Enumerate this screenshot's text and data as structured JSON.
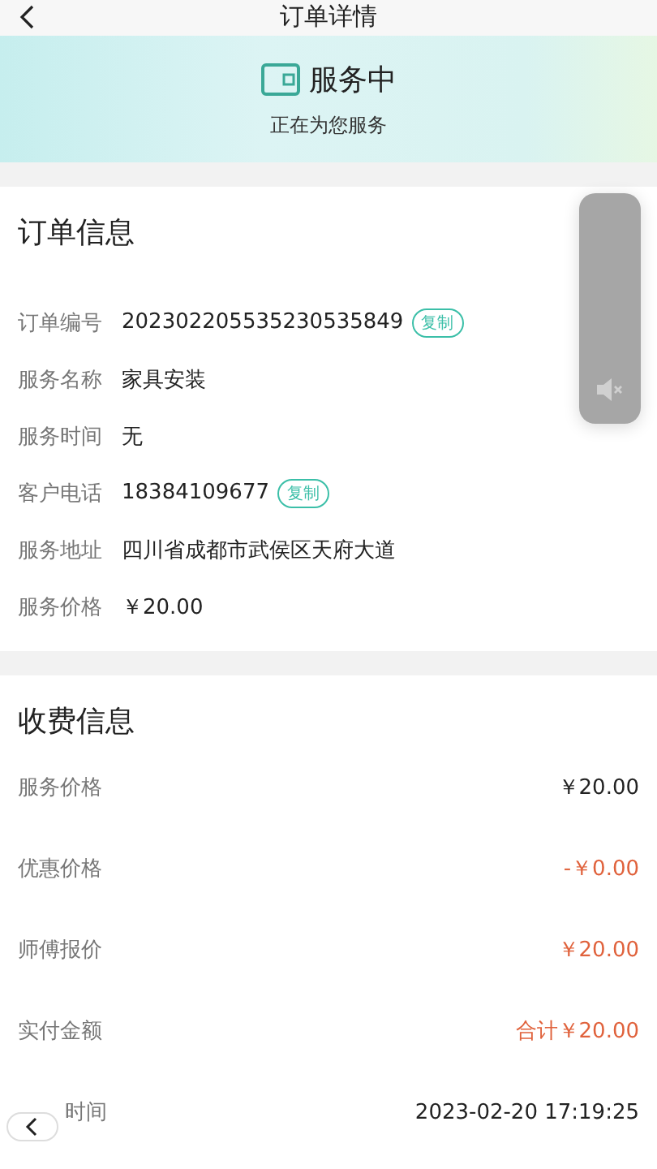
{
  "nav": {
    "title": "订单详情"
  },
  "status": {
    "title": "服务中",
    "subtitle": "正在为您服务"
  },
  "order_info": {
    "title": "订单信息",
    "rows": [
      {
        "label": "订单编号",
        "value": "202302205535230535849",
        "copy": "复制"
      },
      {
        "label": "服务名称",
        "value": "家具安装"
      },
      {
        "label": "服务时间",
        "value": "无"
      },
      {
        "label": "客户电话",
        "value": "18384109677",
        "copy": "复制"
      },
      {
        "label": "服务地址",
        "value": "四川省成都市武侯区天府大道"
      },
      {
        "label": "服务价格",
        "value": "￥20.00"
      }
    ]
  },
  "fee_info": {
    "title": "收费信息",
    "rows": [
      {
        "label": "服务价格",
        "value": "￥20.00",
        "highlight": false
      },
      {
        "label": "优惠价格",
        "value": "-￥0.00",
        "highlight": true
      },
      {
        "label": "师傅报价",
        "value": "￥20.00",
        "highlight": true
      },
      {
        "label": "实付金额",
        "value": "合计￥20.00",
        "highlight": true
      },
      {
        "label": "时间",
        "value": "2023-02-20 17:19:25",
        "highlight": false
      }
    ]
  },
  "volume_overlay": {
    "muted": true
  }
}
